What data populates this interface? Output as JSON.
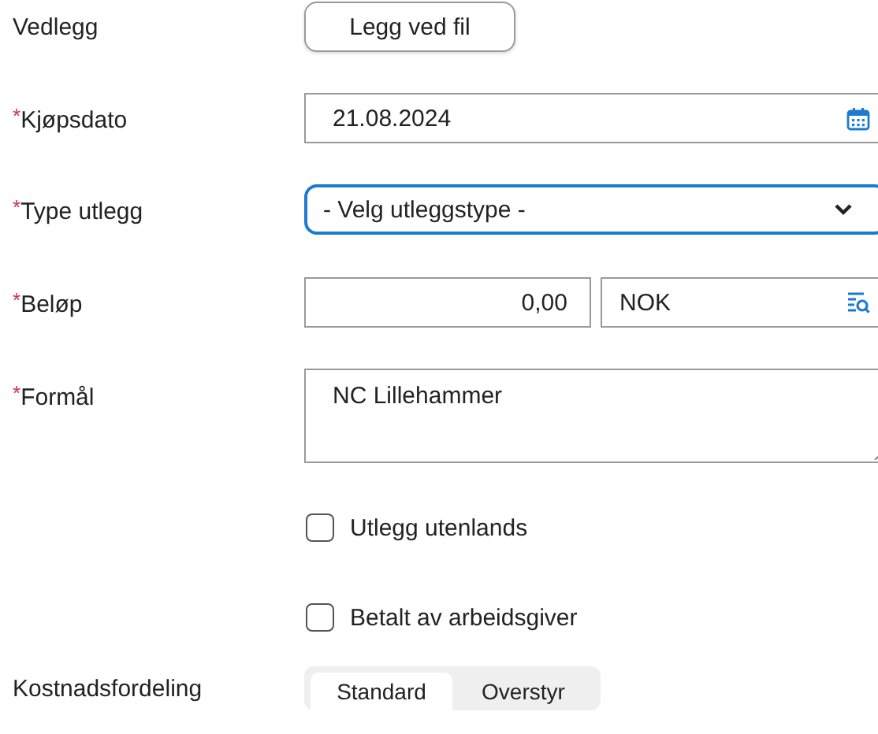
{
  "rows": [
    {
      "kind": "file",
      "label": "Vedlegg",
      "button": "Legg ved fil"
    },
    {
      "kind": "date",
      "label": "Kjøpsdato",
      "required_mark": "*",
      "value": "21.08.2024"
    },
    {
      "kind": "select",
      "label": "Type utlegg",
      "required_mark": "*",
      "value": "- Velg utleggstype -",
      "focused": true
    },
    {
      "kind": "amount",
      "label": "Beløp",
      "required_mark": "*",
      "value": "0,00",
      "currency": "NOK"
    },
    {
      "kind": "textarea",
      "label": "Formål",
      "required_mark": "*",
      "value": "NC Lillehammer"
    },
    {
      "kind": "checkbox",
      "text": "Utlegg utenlands",
      "checked": false
    },
    {
      "kind": "checkbox",
      "text": "Betalt av arbeidsgiver",
      "checked": false
    },
    {
      "kind": "segmented",
      "label": "Kostnadsfordeling",
      "options": [
        {
          "label": "Standard",
          "selected": true
        },
        {
          "label": "Overstyr",
          "selected": false
        }
      ]
    }
  ]
}
